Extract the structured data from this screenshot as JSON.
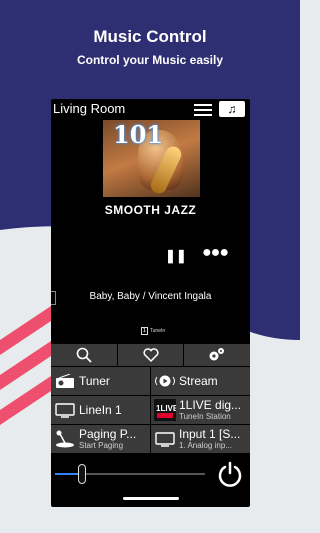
{
  "hero": {
    "title": "Music Control",
    "subtitle": "Control your Music easily"
  },
  "colors": {
    "navy": "#2e2e72",
    "stripe": "#ef4f6e",
    "background": "#e7ebee",
    "volume_accent": "#2f84ff"
  },
  "header": {
    "room": "Living Room",
    "menu_icon": "hamburger-icon",
    "music_icon": "music-note-icon"
  },
  "now_playing": {
    "cover_number": "101",
    "cover_title": "SMOOTH JAZZ",
    "track": "Baby, Baby / Vincent Ingala",
    "source_logo": "TuneIn",
    "pause_icon": "pause-icon",
    "more_icon": "more-icon"
  },
  "toolbar": {
    "items": [
      "search-icon",
      "heart-icon",
      "gears-icon"
    ]
  },
  "sources": [
    {
      "name": "Tuner",
      "sub": "",
      "icon": "radio-icon"
    },
    {
      "name": "Stream",
      "sub": "",
      "icon": "stream-icon"
    },
    {
      "name": "LineIn 1",
      "sub": "",
      "icon": "display-icon"
    },
    {
      "name": "1LIVE dig...",
      "sub": "TuneIn Station",
      "icon": "1live-logo-icon"
    },
    {
      "name": "Paging P...",
      "sub": "Start Paging",
      "icon": "microphone-icon"
    },
    {
      "name": "Input 1 [S...",
      "sub": "1. Analog inp...",
      "icon": "display-icon"
    }
  ],
  "volume": {
    "level": 0.18,
    "power_icon": "power-icon"
  }
}
